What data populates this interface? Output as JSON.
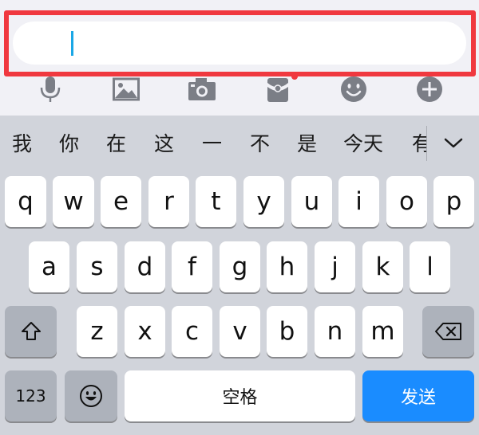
{
  "input": {
    "value": ""
  },
  "toolbar": {
    "icons": [
      "microphone-icon",
      "image-icon",
      "camera-icon",
      "red-packet-icon",
      "emoji-icon",
      "plus-icon"
    ]
  },
  "candidates": [
    "我",
    "你",
    "在",
    "这",
    "一",
    "不",
    "是",
    "今天",
    "有"
  ],
  "keyboard": {
    "row1": [
      "q",
      "w",
      "e",
      "r",
      "t",
      "y",
      "u",
      "i",
      "o",
      "p"
    ],
    "row2": [
      "a",
      "s",
      "d",
      "f",
      "g",
      "h",
      "j",
      "k",
      "l"
    ],
    "row3": [
      "z",
      "x",
      "c",
      "v",
      "b",
      "n",
      "m"
    ],
    "numbers_label": "123",
    "space_label": "空格",
    "send_label": "发送"
  },
  "colors": {
    "highlight": "#f0383f",
    "caret": "#1aa7e6",
    "send": "#1a8cff"
  }
}
